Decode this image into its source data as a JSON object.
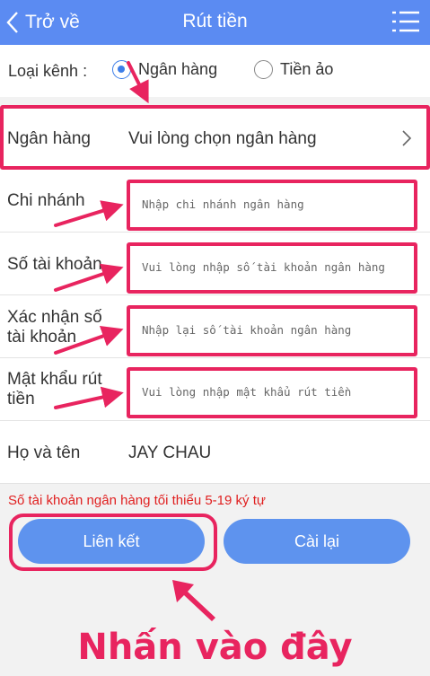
{
  "header": {
    "back_label": "Trở về",
    "title": "Rút tiền"
  },
  "channel": {
    "label": "Loại kênh :",
    "options": [
      "Ngân hàng",
      "Tiền ảo"
    ],
    "selected": "Ngân hàng"
  },
  "bank": {
    "label": "Ngân hàng",
    "placeholder": "Vui lòng chọn ngân hàng"
  },
  "branch": {
    "label": "Chi nhánh",
    "placeholder": "Nhập chi nhánh ngân hàng"
  },
  "account": {
    "label": "Số tài khoản",
    "placeholder": "Vui lòng nhập số tài khoản ngân hàng"
  },
  "confirm_account": {
    "label_line1": "Xác nhận số",
    "label_line2": "tài khoản",
    "placeholder": "Nhập lại số tài khoản ngân hàng"
  },
  "password": {
    "label_line1": "Mật khẩu rút",
    "label_line2": "tiền",
    "placeholder": "Vui lòng nhập mật khẩu rút tiền"
  },
  "name": {
    "label": "Họ và tên",
    "value": "JAY CHAU"
  },
  "hint": "Số tài khoản ngân hàng tối thiểu 5-19 ký tự",
  "buttons": {
    "link": "Liên kết",
    "reset": "Cài lại"
  },
  "callout": "Nhấn vào đây",
  "colors": {
    "header": "#5b8bf2",
    "button": "#5e93ee",
    "annotation": "#e8245f",
    "hint": "#e02020"
  },
  "icons": [
    "chevron-left-icon",
    "menu-icon",
    "chevron-right-icon"
  ]
}
